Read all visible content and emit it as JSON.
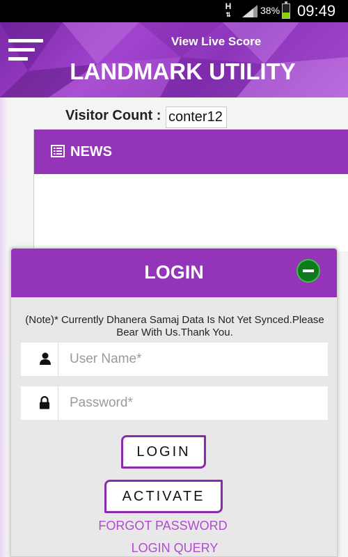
{
  "status_bar": {
    "network": "H",
    "battery_percent": "38%",
    "time": "09:49",
    "battery_level": 0.38
  },
  "header": {
    "menu_icon": "hamburger-menu-icon",
    "live_score_link": "View Live Score",
    "app_title": "LANDMARK UTILITY"
  },
  "visitor": {
    "label": "Visitor Count :",
    "value": "conter12"
  },
  "news": {
    "icon": "news-list-icon",
    "title": "NEWS"
  },
  "login_modal": {
    "title": "LOGIN",
    "close_icon": "minus-circle-icon",
    "note": "(Note)* Currently Dhanera Samaj Data Is Not Yet Synced.Please Bear With Us.Thank You.",
    "username": {
      "icon": "user-icon",
      "placeholder": "User Name*",
      "value": ""
    },
    "password": {
      "icon": "lock-icon",
      "placeholder": "Password*",
      "value": ""
    },
    "login_button": "LOGIN",
    "activate_button": "ACTIVATE",
    "forgot_password_link": "FORGOT PASSWORD",
    "login_query_link": "LOGIN QUERY"
  },
  "colors": {
    "primary": "#9434b8",
    "link": "#b04bd0",
    "close_green": "#0f7a1b"
  }
}
